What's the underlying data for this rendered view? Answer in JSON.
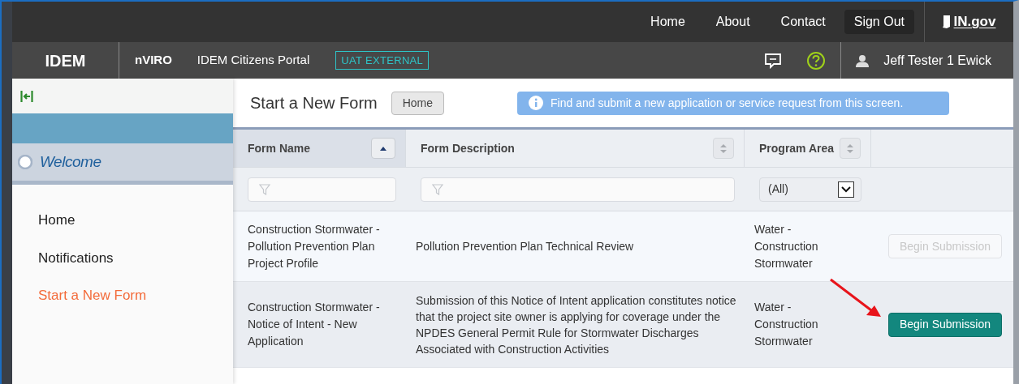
{
  "top_nav": {
    "links": [
      "Home",
      "About",
      "Contact"
    ],
    "sign_out": "Sign Out",
    "logo": "IN.gov"
  },
  "app_bar": {
    "brand": "IDEM",
    "app": "nVIRO",
    "portal": "IDEM Citizens Portal",
    "env_badge": "UAT EXTERNAL",
    "user": "Jeff Tester 1 Ewick"
  },
  "sidebar": {
    "welcome": "Welcome",
    "items": [
      {
        "label": "Home",
        "selected": false
      },
      {
        "label": "Notifications",
        "selected": false
      },
      {
        "label": "Start a New Form",
        "selected": true
      }
    ]
  },
  "page": {
    "title": "Start a New Form",
    "breadcrumb": "Home",
    "info": "Find and submit a new application or service request from this screen."
  },
  "table": {
    "columns": [
      {
        "label": "Form Name",
        "sorted": true,
        "kind": "text"
      },
      {
        "label": "Form Description",
        "sorted": false,
        "kind": "text"
      },
      {
        "label": "Program Area",
        "sorted": false,
        "kind": "select",
        "value": "(All)"
      }
    ],
    "rows": [
      {
        "name": "Construction Stormwater - Pollution Prevention Plan Project Profile",
        "description": "Pollution Prevention Plan Technical Review",
        "area": "Water - Construction Stormwater",
        "action": "Begin Submission",
        "disabled": true
      },
      {
        "name": "Construction Stormwater - Notice of Intent - New Application",
        "description": "Submission of this Notice of Intent application constitutes notice that the project site owner is applying for coverage under the NPDES General Permit Rule for Stormwater Discharges Associated with Construction Activities",
        "area": "Water - Construction Stormwater",
        "action": "Begin Submission",
        "disabled": false
      }
    ]
  }
}
